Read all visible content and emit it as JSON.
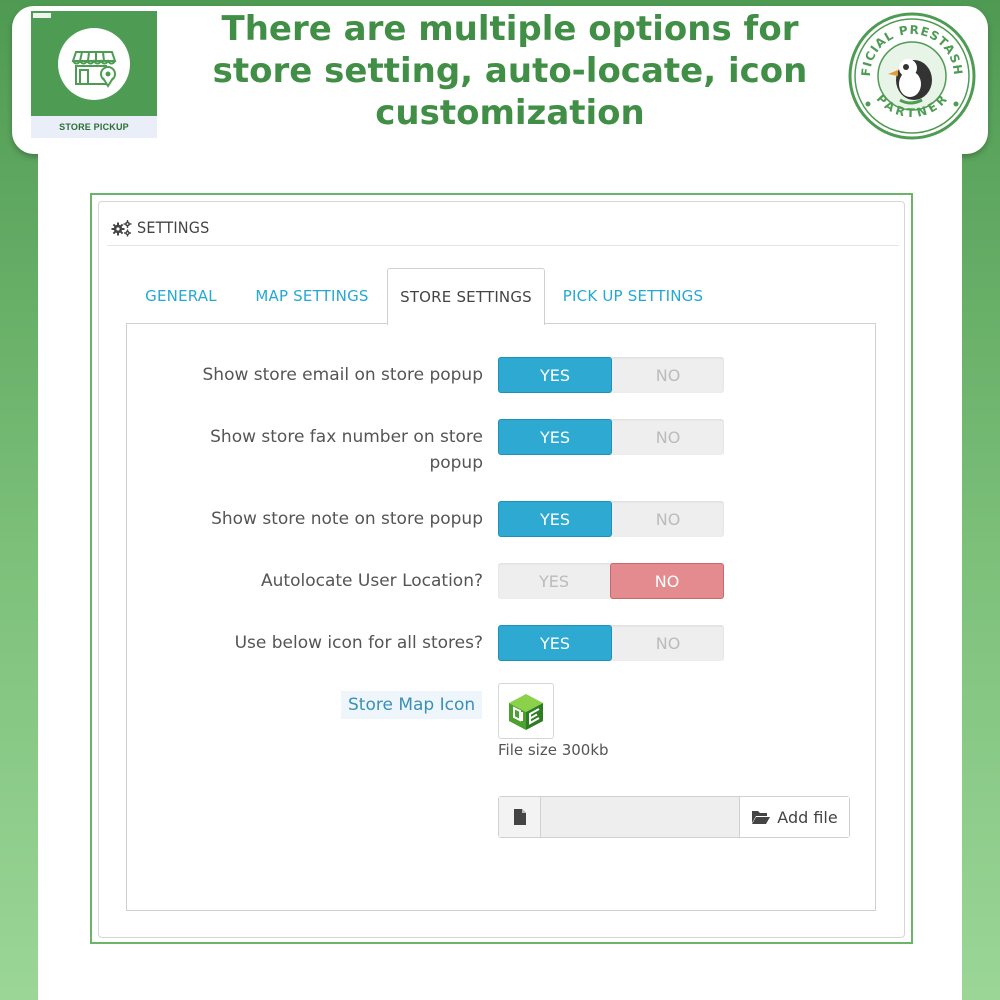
{
  "banner": {
    "headline_line1": "There are multiple options for",
    "headline_line2": "store setting, auto-locate, icon",
    "headline_line3": "customization",
    "logo_caption": "STORE PICKUP",
    "badge_text_top": "OFFICIAL PRESTASHOP",
    "badge_text_bottom": "PARTNER"
  },
  "panel": {
    "title": "SETTINGS"
  },
  "tabs": [
    {
      "label": "GENERAL",
      "active": false
    },
    {
      "label": "MAP SETTINGS",
      "active": false
    },
    {
      "label": "STORE SETTINGS",
      "active": true
    },
    {
      "label": "PICK UP SETTINGS",
      "active": false
    }
  ],
  "rows": [
    {
      "label": "Show store email on store popup",
      "yes": "YES",
      "no": "NO",
      "value": "YES"
    },
    {
      "label": "Show store fax number on store",
      "label2": "popup",
      "yes": "YES",
      "no": "NO",
      "value": "YES"
    },
    {
      "label": "Show store note on store popup",
      "yes": "YES",
      "no": "NO",
      "value": "YES"
    },
    {
      "label": "Autolocate User Location?",
      "yes": "YES",
      "no": "NO",
      "value": "NO"
    },
    {
      "label": "Use below icon for all stores?",
      "yes": "YES",
      "no": "NO",
      "value": "YES"
    }
  ],
  "store_map_icon": {
    "label": "Store Map Icon",
    "file_size": "File size 300kb",
    "add_file": "Add file",
    "file_value": ""
  },
  "colors": {
    "brand_green": "#418f46",
    "yes_active": "#2eaad2",
    "no_active": "#e38b8f",
    "tab_link": "#25a8d6"
  }
}
